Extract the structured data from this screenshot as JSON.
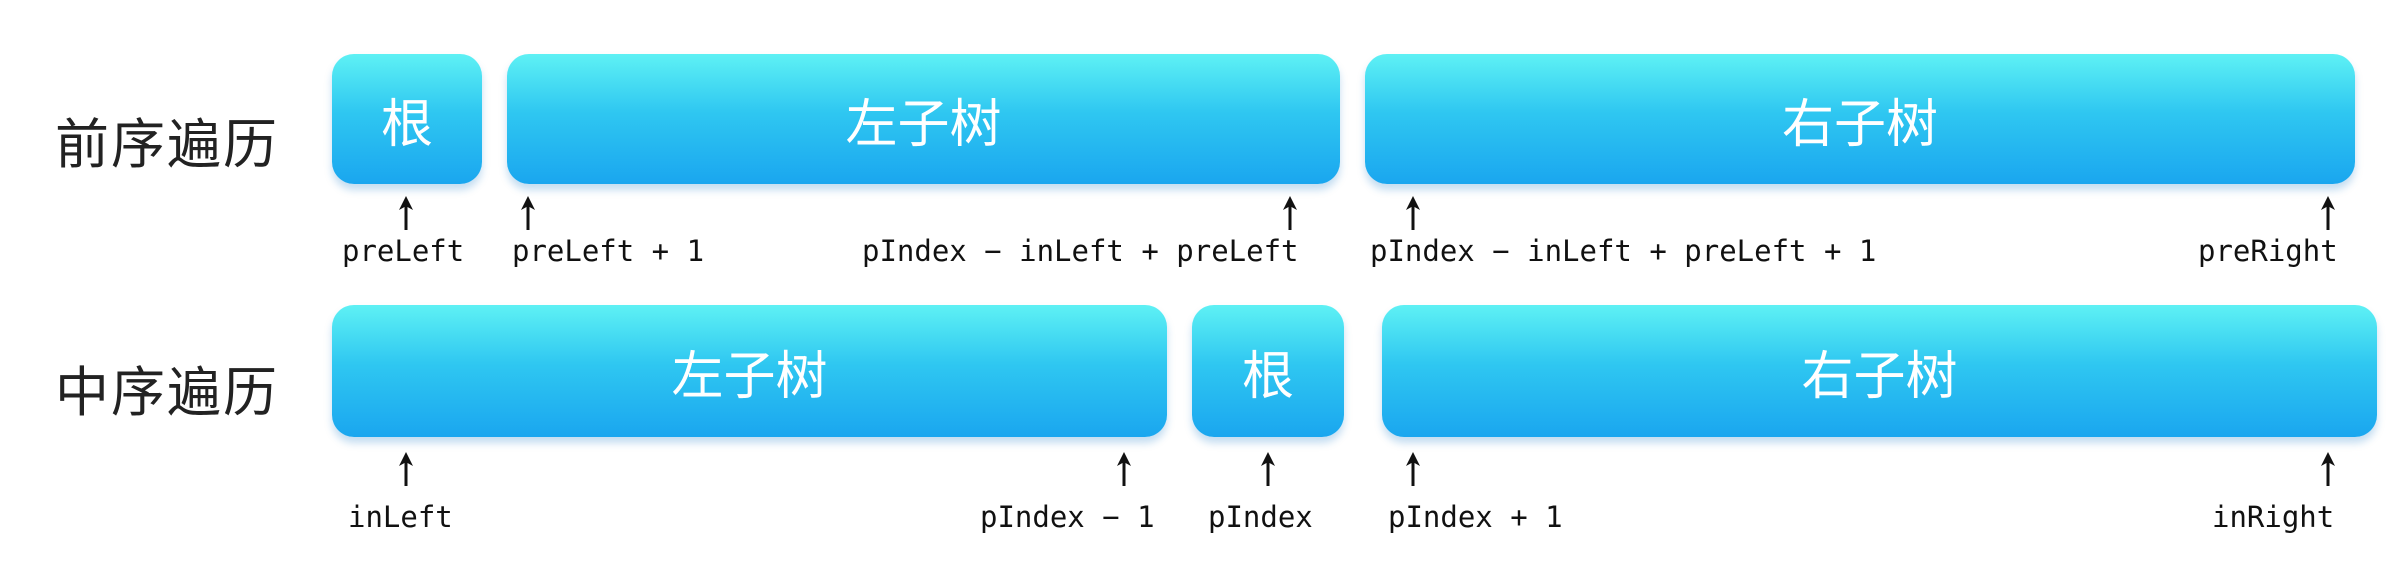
{
  "preorder": {
    "label": "前序遍历",
    "boxes": {
      "root": "根",
      "left": "左子树",
      "right": "右子树"
    },
    "indices": {
      "pre_left": "preLeft",
      "pre_left_plus_1": "preLeft + 1",
      "left_end": "pIndex − inLeft + preLeft",
      "right_start": "pIndex − inLeft + preLeft + 1",
      "pre_right": "preRight"
    }
  },
  "inorder": {
    "label": "中序遍历",
    "boxes": {
      "left": "左子树",
      "root": "根",
      "right": "右子树"
    },
    "indices": {
      "in_left": "inLeft",
      "pindex_minus_1": "pIndex − 1",
      "pindex": "pIndex",
      "pindex_plus_1": "pIndex + 1",
      "in_right": "inRight"
    }
  }
}
